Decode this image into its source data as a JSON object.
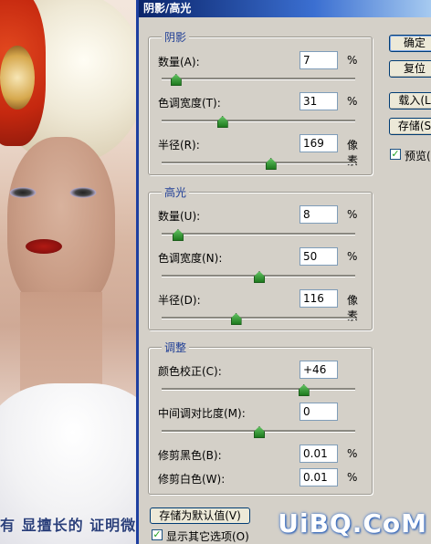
{
  "window": {
    "title": "阴影/高光"
  },
  "shadows": {
    "title": "阴影",
    "amount": {
      "label": "数量(A):",
      "value": "7",
      "unit": "%",
      "fraction": 0.07
    },
    "tonal_width": {
      "label": "色调宽度(T):",
      "value": "31",
      "unit": "%",
      "fraction": 0.31
    },
    "radius": {
      "label": "半径(R):",
      "value": "169",
      "unit": "像素",
      "fraction": 0.56
    }
  },
  "highlights": {
    "title": "高光",
    "amount": {
      "label": "数量(U):",
      "value": "8",
      "unit": "%",
      "fraction": 0.08
    },
    "tonal_width": {
      "label": "色调宽度(N):",
      "value": "50",
      "unit": "%",
      "fraction": 0.5
    },
    "radius": {
      "label": "半径(D):",
      "value": "116",
      "unit": "像素",
      "fraction": 0.38
    }
  },
  "adjustments": {
    "title": "调整",
    "color_correction": {
      "label": "颜色校正(C):",
      "value": "+46",
      "fraction": 0.73
    },
    "midtone_contrast": {
      "label": "中间调对比度(M):",
      "value": "0",
      "fraction": 0.5
    },
    "black_clip": {
      "label": "修剪黑色(B):",
      "value": "0.01",
      "unit": "%"
    },
    "white_clip": {
      "label": "修剪白色(W):",
      "value": "0.01",
      "unit": "%"
    }
  },
  "buttons": {
    "ok": "确定",
    "reset": "复位",
    "load": "载入(L",
    "save": "存储(S"
  },
  "preview": {
    "label": "预览(P",
    "checked": true
  },
  "save_default": "存储为默认值(V)",
  "show_more": {
    "label": "显示其它选项(O)",
    "checked": true
  },
  "photo_caption": "有 显擅长的 证明微的选择",
  "watermark": "UiBQ.CoM",
  "colors": {
    "title_start": "#0a246a",
    "group_title": "#1f3e96",
    "thumb": "#2e9b2e"
  }
}
